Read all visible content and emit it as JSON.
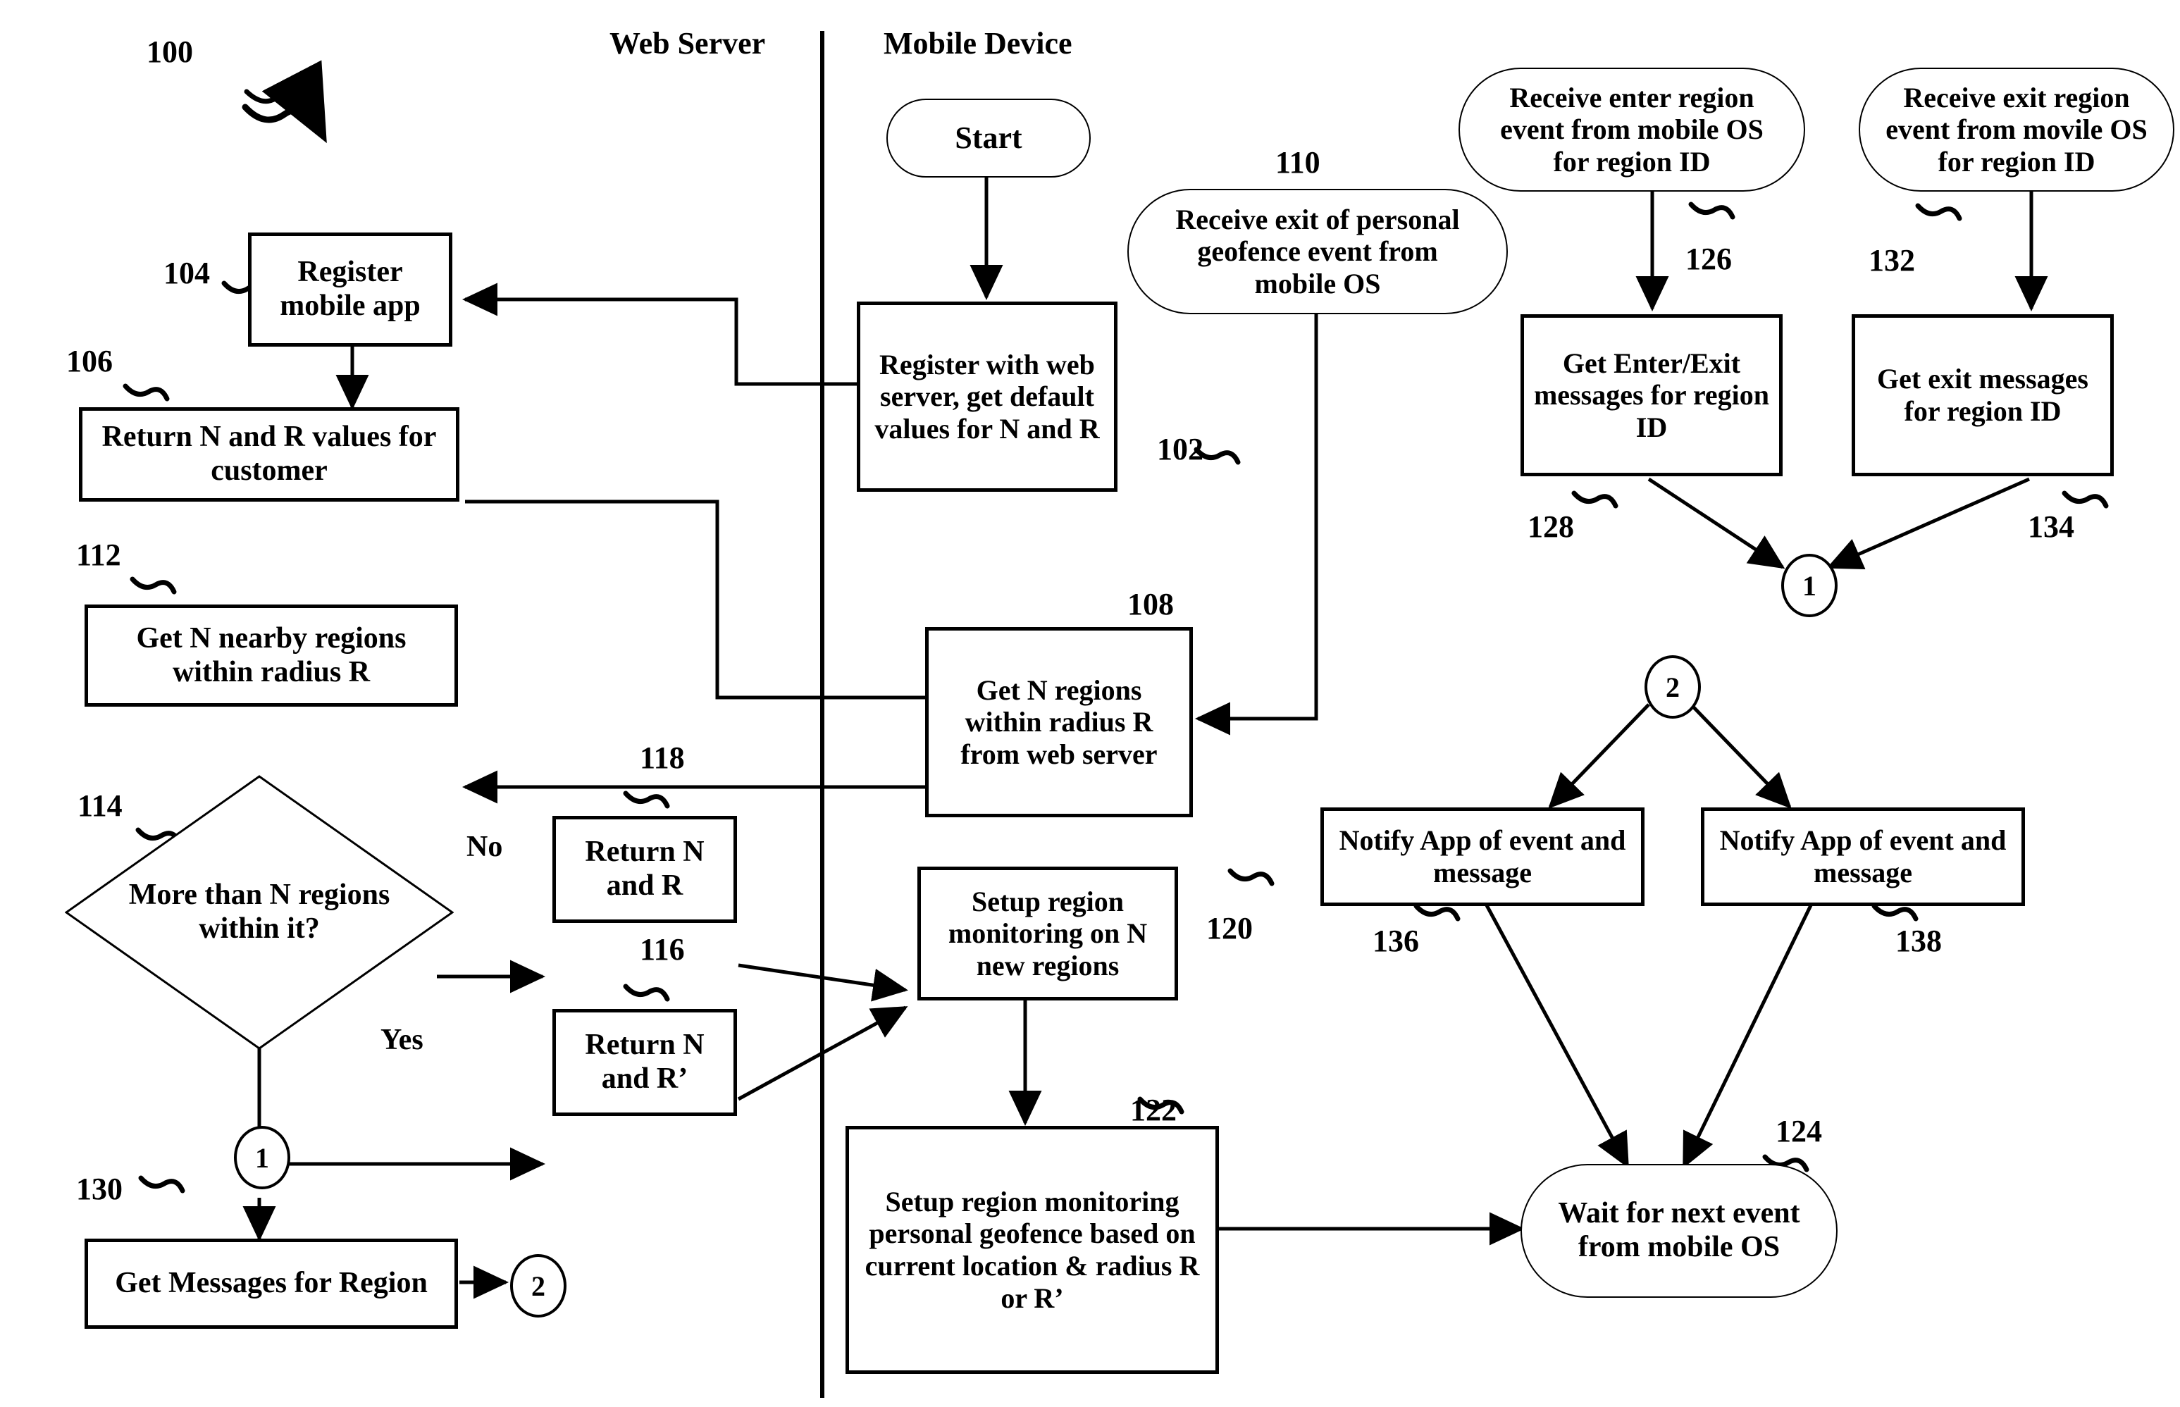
{
  "figure": {
    "number": "100",
    "lanes": [
      {
        "id": "web-server",
        "title": "Web Server"
      },
      {
        "id": "mobile-device",
        "title": "Mobile Device"
      }
    ]
  },
  "nodes": {
    "start": {
      "ref": "",
      "text": "Start"
    },
    "n102": {
      "ref": "102",
      "text": "Register with web server, get default values for N and R"
    },
    "n104": {
      "ref": "104",
      "text": "Register mobile app"
    },
    "n106": {
      "ref": "106",
      "text": "Return N and R values for customer"
    },
    "n108": {
      "ref": "108",
      "text": "Get N regions within radius R from web server"
    },
    "n110": {
      "ref": "110",
      "text": "Receive exit of personal geofence event from mobile OS"
    },
    "n112": {
      "ref": "112",
      "text": "Get N nearby regions within radius R"
    },
    "n114": {
      "ref": "114",
      "text": "More than N regions within it?"
    },
    "n116": {
      "ref": "116",
      "text": "Return N and R’"
    },
    "n118": {
      "ref": "118",
      "text": "Return N and R"
    },
    "n120": {
      "ref": "120",
      "text": "Setup region monitoring on N new regions"
    },
    "n122": {
      "ref": "122",
      "text": "Setup region monitoring personal geofence based on current location & radius R or R’"
    },
    "n124": {
      "ref": "124",
      "text": "Wait for next event from mobile OS"
    },
    "n126": {
      "ref": "126",
      "text": "Receive enter region event from mobile OS for region ID"
    },
    "n128": {
      "ref": "128",
      "text": "Get Enter/Exit messages for region ID"
    },
    "n130": {
      "ref": "130",
      "text": "Get Messages for Region"
    },
    "n132": {
      "ref": "132",
      "text": "Receive exit region event from movile OS for region ID"
    },
    "n134": {
      "ref": "134",
      "text": "Get exit messages for region ID"
    },
    "n136": {
      "ref": "136",
      "text": "Notify App of event and message"
    },
    "n138": {
      "ref": "138",
      "text": "Notify App of event and message"
    }
  },
  "connectors": {
    "c1_top": {
      "label": "1"
    },
    "c1_bottom": {
      "label": "1"
    },
    "c2_top": {
      "label": "2"
    },
    "c2_bottom": {
      "label": "2"
    }
  },
  "edge_labels": {
    "no": "No",
    "yes": "Yes"
  },
  "colors": {
    "stroke": "#000000",
    "background": "#ffffff",
    "text": "#000000"
  }
}
